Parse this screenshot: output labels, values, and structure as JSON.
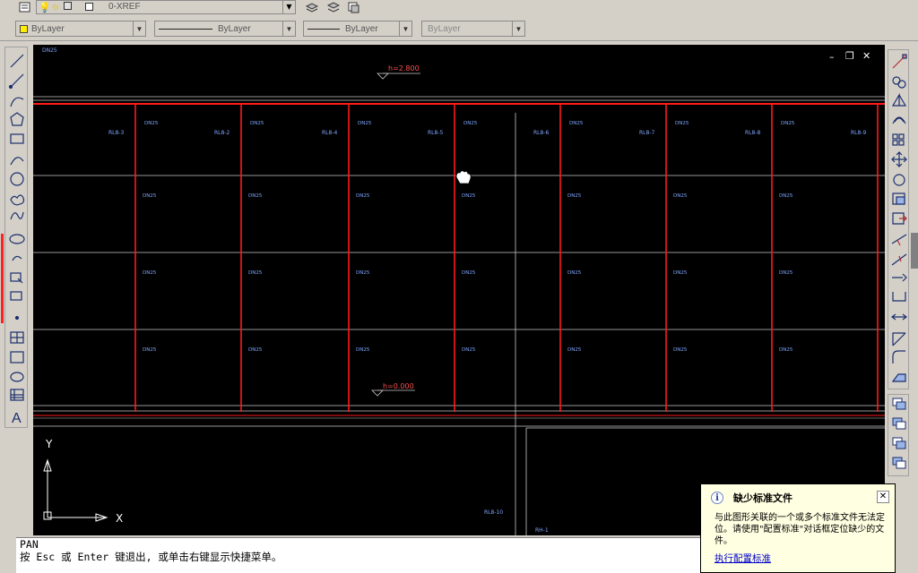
{
  "toolbar": {
    "layer_name": "0-XREF",
    "color_value": "ByLayer",
    "linetype_value": "ByLayer",
    "lineweight_value": "ByLayer",
    "plotstyle_value": "ByLayer"
  },
  "drawing": {
    "top_left_label": "DN25",
    "window_controls": {
      "minimize": "–",
      "restore": "❐",
      "close": "✕"
    },
    "elevations": [
      "h=2.800",
      "h=0.000"
    ],
    "top_labels": [
      "DN25",
      "DN25",
      "DN25",
      "DN25",
      "DN25",
      "DN25",
      "DN25",
      "DN25",
      "DN25",
      "DN25",
      "DN25",
      "DN25"
    ],
    "riser_labels": [
      "RL8-3",
      "RL8-2",
      "RL8-4",
      "RL8-5",
      "RL8-6",
      "RL8-7",
      "RL8-8",
      "RL8-9"
    ],
    "ucs": {
      "y_label": "Y",
      "x_label": "X"
    },
    "bottom_label": "RL8-10",
    "bottom_label_2": "RH-1"
  },
  "command_line": {
    "line1": "PAN",
    "line2": "按 Esc 或 Enter 键退出, 或单击右键显示快捷菜单。"
  },
  "notification": {
    "title": "缺少标准文件",
    "body": "与此图形关联的一个或多个标准文件无法定位。请使用\"配置标准\"对话框定位缺少的文件。",
    "link": "执行配置标准"
  },
  "colors": {
    "background": "#000000",
    "pipe_red": "#ff1a1a",
    "label_blue": "#7fa7ff",
    "line_white": "#d0d0d0"
  }
}
